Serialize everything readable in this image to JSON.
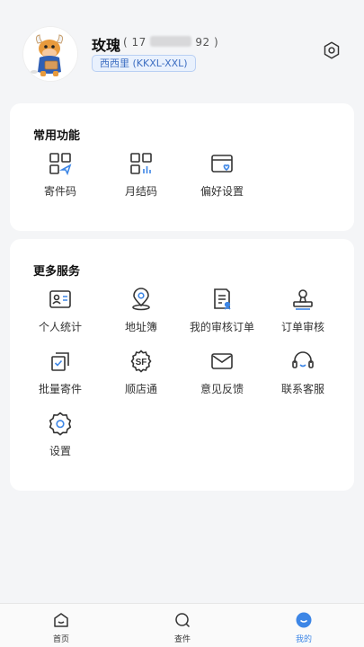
{
  "profile": {
    "name": "玫瑰",
    "phone_prefix": "( 17",
    "phone_suffix": "92 )",
    "station": "西西里 (KKXL-XXL)",
    "avatar": "bull-mascot-avatar",
    "settings_icon": "gear-icon"
  },
  "common": {
    "title": "常用功能",
    "items": [
      {
        "label": "寄件码",
        "icon": "mail-code-icon"
      },
      {
        "label": "月结码",
        "icon": "monthly-code-icon"
      },
      {
        "label": "偏好设置",
        "icon": "preference-card-icon"
      }
    ]
  },
  "more": {
    "title": "更多服务",
    "items": [
      {
        "label": "个人统计",
        "icon": "id-card-icon"
      },
      {
        "label": "地址簿",
        "icon": "location-pin-icon"
      },
      {
        "label": "我的审核订单",
        "icon": "review-document-icon"
      },
      {
        "label": "订单审核",
        "icon": "stamp-icon"
      },
      {
        "label": "批量寄件",
        "icon": "batch-check-icon"
      },
      {
        "label": "顺店通",
        "icon": "sf-logo-icon"
      },
      {
        "label": "意见反馈",
        "icon": "envelope-icon"
      },
      {
        "label": "联系客服",
        "icon": "headset-icon"
      },
      {
        "label": "设置",
        "icon": "gear-icon"
      }
    ]
  },
  "tabbar": {
    "items": [
      {
        "label": "首页",
        "icon": "home-icon"
      },
      {
        "label": "查件",
        "icon": "search-icon"
      },
      {
        "label": "我的",
        "icon": "profile-icon"
      }
    ],
    "active_index": 2
  },
  "colors": {
    "accent": "#3d86e6",
    "icon_stroke": "#333333",
    "badge_bg": "#e9f1fd",
    "badge_text": "#3e6fc2"
  }
}
